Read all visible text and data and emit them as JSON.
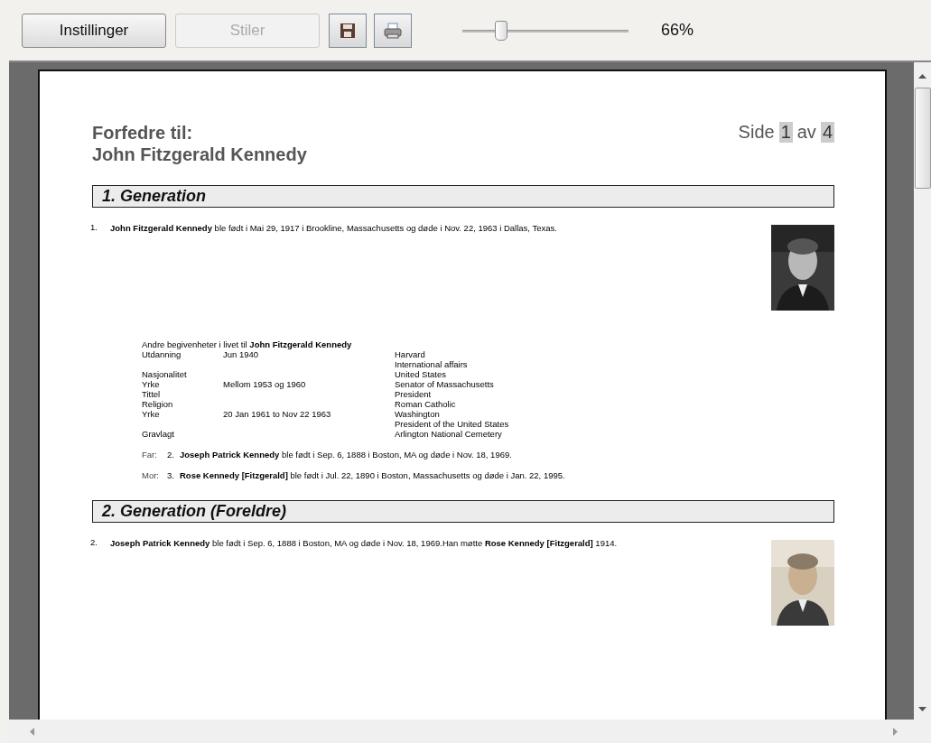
{
  "toolbar": {
    "buttons": [
      {
        "label": "Instillinger",
        "disabled": false
      },
      {
        "label": "Stiler",
        "disabled": true
      }
    ],
    "zoom": {
      "level": 0.23,
      "reading": "66%"
    }
  },
  "page": {
    "title": [
      "Forfedre til:",
      "John Fitzgerald Kennedy"
    ],
    "page_label": {
      "prefix": "Side",
      "current": "1",
      "of": "av",
      "total": "4"
    },
    "sections": [
      {
        "heading": "1. Generation",
        "entries": [
          {
            "number": "1.",
            "text": "**John Fitzgerald Kennedy** ble født i Mai 29, 1917 i Brookline, Massachusetts og døde i Nov. 22, 1963 i Dallas, Texas.",
            "photo": {
              "kind": "picture"
            },
            "events": {
              "title": "Andre begivenheter i livet til **John Fitzgerald Kennedy**",
              "rows": [
                [
                  "Utdanning",
                  "Jun 1940",
                  "Harvard"
                ],
                [
                  "",
                  "",
                  "International affairs"
                ],
                [
                  "Nasjonalitet",
                  "",
                  "United States"
                ],
                [
                  "Yrke",
                  "Mellom 1953 og 1960",
                  "Senator of Massachusetts"
                ],
                [
                  "Tittel",
                  "",
                  "President"
                ],
                [
                  "Religion",
                  "",
                  "Roman Catholic"
                ],
                [
                  "Yrke",
                  "20 Jan 1961 to Nov 22 1963",
                  "Washington"
                ],
                [
                  "",
                  "",
                  "President of the United States"
                ],
                [
                  "Gravlagt",
                  "",
                  "Arlington National Cemetery"
                ]
              ]
            },
            "parents": [
              {
                "label": "Far:",
                "number": "2.",
                "text": "**Joseph Patrick Kennedy** ble født i Sep. 6, 1888 i Boston, MA og døde i Nov. 18, 1969."
              },
              {
                "label": "Mor:",
                "number": "3.",
                "text": "**Rose Kennedy [Fitzgerald]** ble født i Jul. 22, 1890 i Boston, Massachusetts og døde i Jan. 22, 1995."
              }
            ]
          }
        ]
      },
      {
        "heading": "2. Generation  (Foreldre)",
        "entries": [
          {
            "number": "2.",
            "text": "**Joseph Patrick Kennedy** ble født i Sep. 6, 1888 i Boston, MA og døde i Nov. 18, 1969.Han møtte **Rose Kennedy [Fitzgerald]** 1914.",
            "photo": {
              "kind": "picture"
            }
          }
        ]
      }
    ]
  }
}
